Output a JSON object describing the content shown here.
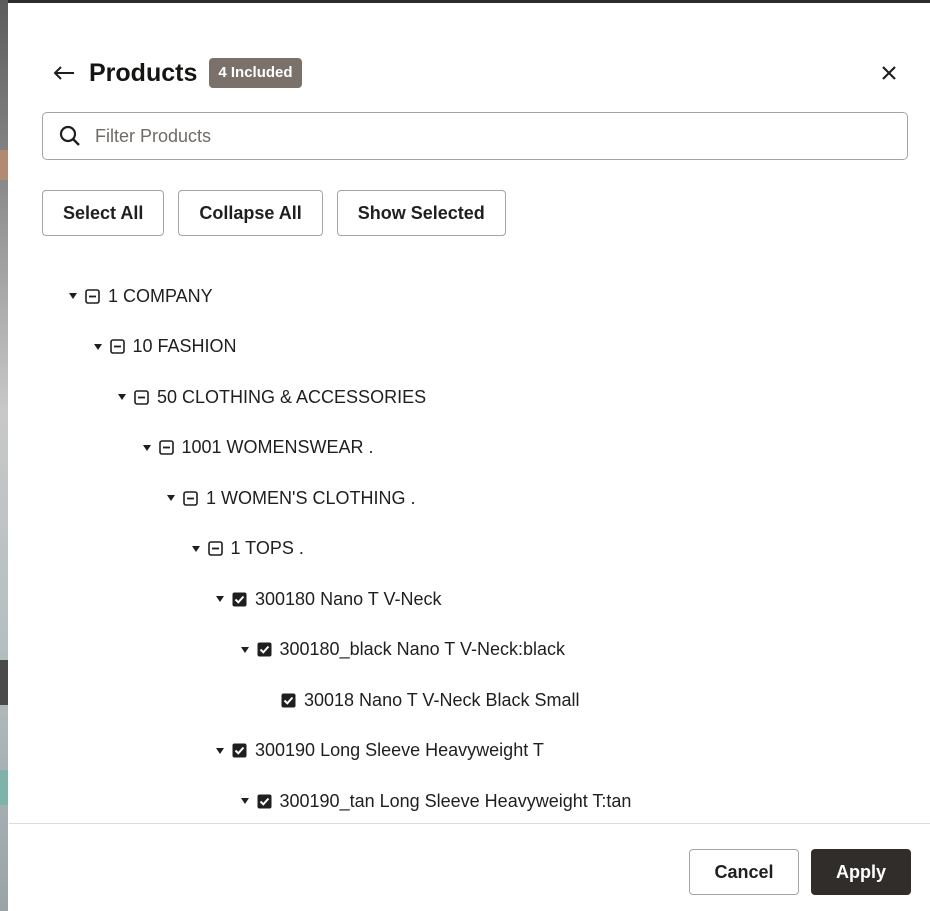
{
  "header": {
    "title": "Products",
    "badge": "4 Included",
    "back_icon": "arrow-left-icon",
    "close_icon": "close-icon"
  },
  "search": {
    "placeholder": "Filter Products",
    "value": "",
    "icon": "search-icon"
  },
  "toolbar": {
    "select_all": "Select All",
    "collapse_all": "Collapse All",
    "show_selected": "Show Selected"
  },
  "tree": [
    {
      "label": "1 COMPANY",
      "level": 0,
      "expanded": true,
      "state": "partial"
    },
    {
      "label": "10 FASHION",
      "level": 1,
      "expanded": true,
      "state": "partial"
    },
    {
      "label": "50 CLOTHING & ACCESSORIES",
      "level": 2,
      "expanded": true,
      "state": "partial"
    },
    {
      "label": "1001 WOMENSWEAR .",
      "level": 3,
      "expanded": true,
      "state": "partial"
    },
    {
      "label": "1 WOMEN'S CLOTHING .",
      "level": 4,
      "expanded": true,
      "state": "partial"
    },
    {
      "label": "1 TOPS .",
      "level": 5,
      "expanded": true,
      "state": "partial"
    },
    {
      "label": "300180 Nano T V-Neck",
      "level": 6,
      "expanded": true,
      "state": "checked"
    },
    {
      "label": "300180_black Nano T V-Neck:black",
      "level": 7,
      "expanded": true,
      "state": "checked"
    },
    {
      "label": "30018 Nano T V-Neck Black Small",
      "level": 8,
      "leaf": true,
      "state": "checked"
    },
    {
      "label": "300190 Long Sleeve Heavyweight T",
      "level": 6,
      "expanded": true,
      "state": "checked"
    },
    {
      "label": "300190_tan Long Sleeve Heavyweight T:tan",
      "level": 7,
      "expanded": true,
      "state": "checked"
    }
  ],
  "footer": {
    "cancel": "Cancel",
    "apply": "Apply"
  },
  "colors": {
    "badge_bg": "#7a716b",
    "apply_bg": "#312d2a",
    "border": "#a8a39f",
    "text": "#1f1f1f"
  }
}
